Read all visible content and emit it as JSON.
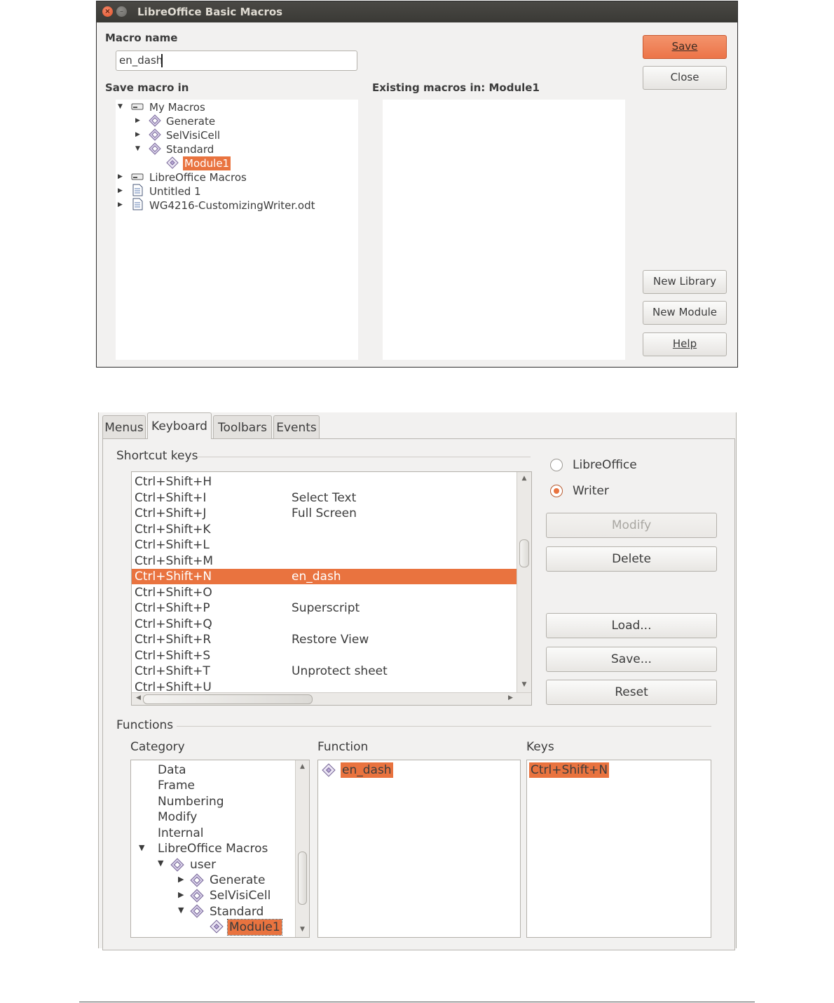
{
  "dialog1": {
    "title": "LibreOffice Basic Macros",
    "macro_name_label": "Macro name",
    "macro_name_value": "en_dash",
    "save_macro_in_label": "Save macro in",
    "existing_macros_label": "Existing macros in: Module1",
    "tree": [
      {
        "label": "My Macros"
      },
      {
        "label": "Generate"
      },
      {
        "label": "SelVisiCell"
      },
      {
        "label": "Standard"
      },
      {
        "label": "Module1"
      },
      {
        "label": "LibreOffice Macros"
      },
      {
        "label": "Untitled 1"
      },
      {
        "label": "WG4216-CustomizingWriter.odt"
      }
    ],
    "buttons": {
      "save": "Save",
      "close": "Close",
      "new_library": "New Library",
      "new_module": "New Module",
      "help": "Help"
    }
  },
  "dialog2": {
    "tabs": [
      "Menus",
      "Keyboard",
      "Toolbars",
      "Events"
    ],
    "active_tab": "Keyboard",
    "shortcut_keys_label": "Shortcut keys",
    "shortcuts": [
      {
        "key": "Ctrl+Shift+H",
        "func": ""
      },
      {
        "key": "Ctrl+Shift+I",
        "func": "Select Text"
      },
      {
        "key": "Ctrl+Shift+J",
        "func": "Full Screen"
      },
      {
        "key": "Ctrl+Shift+K",
        "func": ""
      },
      {
        "key": "Ctrl+Shift+L",
        "func": ""
      },
      {
        "key": "Ctrl+Shift+M",
        "func": ""
      },
      {
        "key": "Ctrl+Shift+N",
        "func": "en_dash"
      },
      {
        "key": "Ctrl+Shift+O",
        "func": ""
      },
      {
        "key": "Ctrl+Shift+P",
        "func": "Superscript"
      },
      {
        "key": "Ctrl+Shift+Q",
        "func": ""
      },
      {
        "key": "Ctrl+Shift+R",
        "func": "Restore View"
      },
      {
        "key": "Ctrl+Shift+S",
        "func": ""
      },
      {
        "key": "Ctrl+Shift+T",
        "func": "Unprotect sheet"
      },
      {
        "key": "Ctrl+Shift+U",
        "func": ""
      }
    ],
    "selected_shortcut": "Ctrl+Shift+N",
    "radio": {
      "libreoffice": "LibreOffice",
      "writer": "Writer",
      "selected": "Writer"
    },
    "buttons": {
      "modify": "Modify",
      "delete": "Delete",
      "load": "Load...",
      "save": "Save...",
      "reset": "Reset"
    },
    "functions_label": "Functions",
    "category_label": "Category",
    "function_label": "Function",
    "keys_label": "Keys",
    "categories": [
      {
        "label": "Data"
      },
      {
        "label": "Frame"
      },
      {
        "label": "Numbering"
      },
      {
        "label": "Modify"
      },
      {
        "label": "Internal"
      },
      {
        "label": "LibreOffice Macros"
      },
      {
        "label": "user"
      },
      {
        "label": "Generate"
      },
      {
        "label": "SelVisiCell"
      },
      {
        "label": "Standard"
      },
      {
        "label": "Module1"
      }
    ],
    "function_items": [
      {
        "label": "en_dash"
      }
    ],
    "key_items": [
      {
        "label": "Ctrl+Shift+N"
      }
    ],
    "colors": {
      "accent": "#e9733f",
      "dialog_bg": "#f2f1f0",
      "titlebar": "#3c3b37"
    }
  }
}
